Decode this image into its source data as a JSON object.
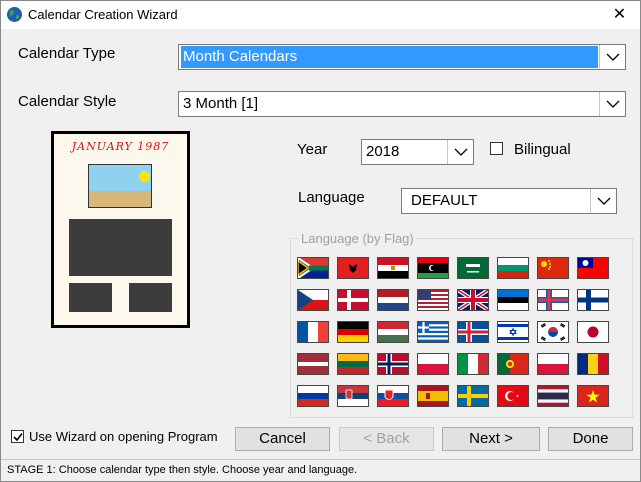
{
  "window": {
    "title": "Calendar Creation Wizard",
    "close_glyph": "✕"
  },
  "calendar_type": {
    "label": "Calendar Type",
    "value": "Month Calendars"
  },
  "calendar_style": {
    "label": "Calendar Style",
    "value": "3 Month [1]"
  },
  "preview": {
    "title": "JANUARY 1987"
  },
  "year": {
    "label": "Year",
    "value": "2018"
  },
  "bilingual": {
    "label": "Bilingual",
    "checked": false
  },
  "language": {
    "label": "Language",
    "value": "DEFAULT"
  },
  "flags_group": {
    "label": "Language (by Flag)",
    "rows": [
      [
        "south-africa",
        "albania",
        "egypt",
        "libya",
        "saudi-arabia",
        "bulgaria",
        "china",
        "taiwan"
      ],
      [
        "czech-republic",
        "denmark",
        "netherlands",
        "usa",
        "united-kingdom",
        "estonia",
        "faroe-islands",
        "finland"
      ],
      [
        "france",
        "germany",
        "hungary",
        "greece",
        "iceland",
        "israel",
        "south-korea",
        "japan"
      ],
      [
        "latvia",
        "lithuania",
        "norway",
        "poland",
        "italy",
        "portugal",
        "poland-2",
        "romania"
      ],
      [
        "russia",
        "serbia",
        "slovakia",
        "spain",
        "sweden",
        "turkey",
        "thailand",
        "vietnam"
      ]
    ]
  },
  "wizard_option": {
    "label": "Use Wizard on opening Program",
    "checked": true
  },
  "buttons": {
    "cancel": "Cancel",
    "back": "< Back",
    "next": "Next >",
    "done": "Done"
  },
  "status": {
    "text": "STAGE 1: Choose calendar type then style. Choose year and language."
  }
}
